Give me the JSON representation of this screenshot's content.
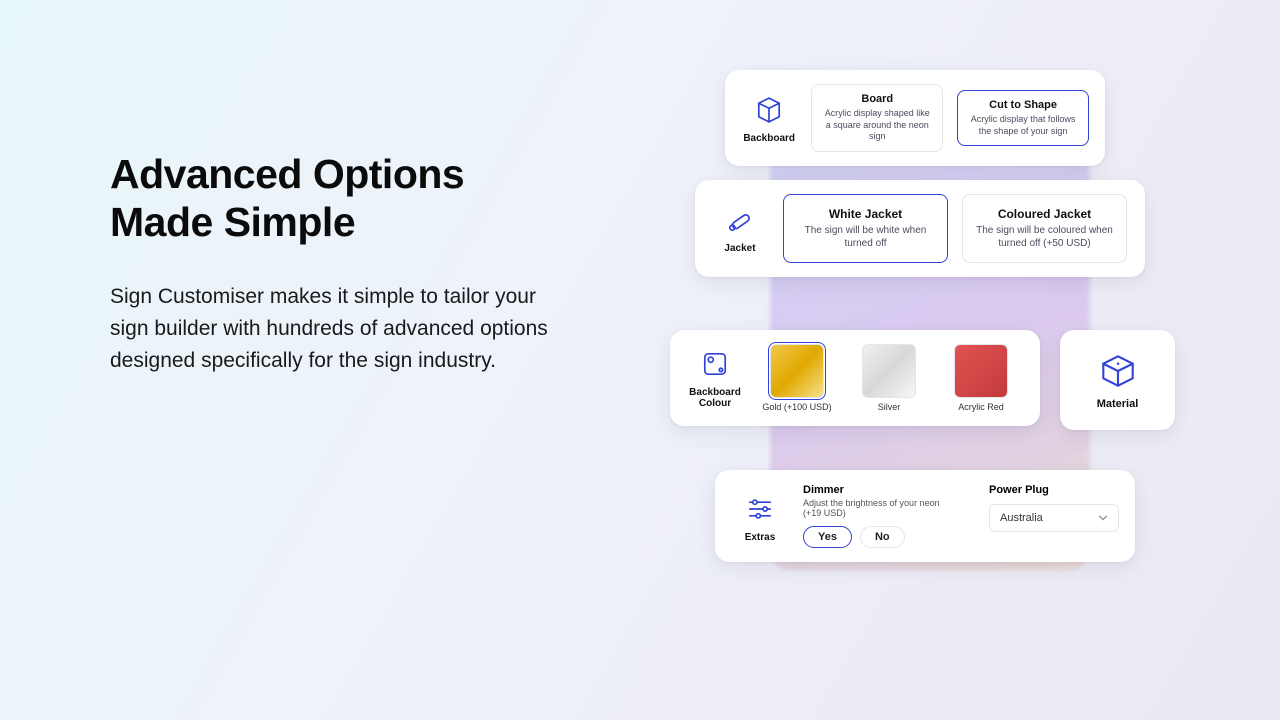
{
  "copy": {
    "heading_l1": "Advanced Options",
    "heading_l2": "Made Simple",
    "body": "Sign Customiser makes it simple to tailor your sign builder with hundreds of advanced options designed specifically for the sign industry."
  },
  "backboard": {
    "label": "Backboard",
    "opts": [
      {
        "title": "Board",
        "desc": "Acrylic display shaped like a square around the neon sign"
      },
      {
        "title": "Cut to Shape",
        "desc": "Acrylic display that follows the shape of your sign"
      }
    ]
  },
  "jacket": {
    "label": "Jacket",
    "opts": [
      {
        "title": "White Jacket",
        "desc": "The sign will be white when turned off"
      },
      {
        "title": "Coloured Jacket",
        "desc": "The sign will be coloured when turned off (+50 USD)"
      }
    ]
  },
  "colour": {
    "label_l1": "Backboard",
    "label_l2": "Colour",
    "swatches": [
      {
        "name": "Gold (+100 USD)",
        "css": "linear-gradient(135deg,#f2c94c,#e0a800,#f7e08a)"
      },
      {
        "name": "Silver",
        "css": "linear-gradient(135deg,#f0f0f0,#d8d8d8,#f7f7f7)"
      },
      {
        "name": "Acrylic Red",
        "css": "linear-gradient(135deg,#e25353,#c23a3a)"
      }
    ]
  },
  "material": {
    "label": "Material"
  },
  "extras": {
    "label": "Extras",
    "dimmer_title": "Dimmer",
    "dimmer_desc": "Adjust the brightness of your neon (+19 USD)",
    "yes": "Yes",
    "no": "No",
    "plug_title": "Power Plug",
    "plug_value": "Australia"
  }
}
